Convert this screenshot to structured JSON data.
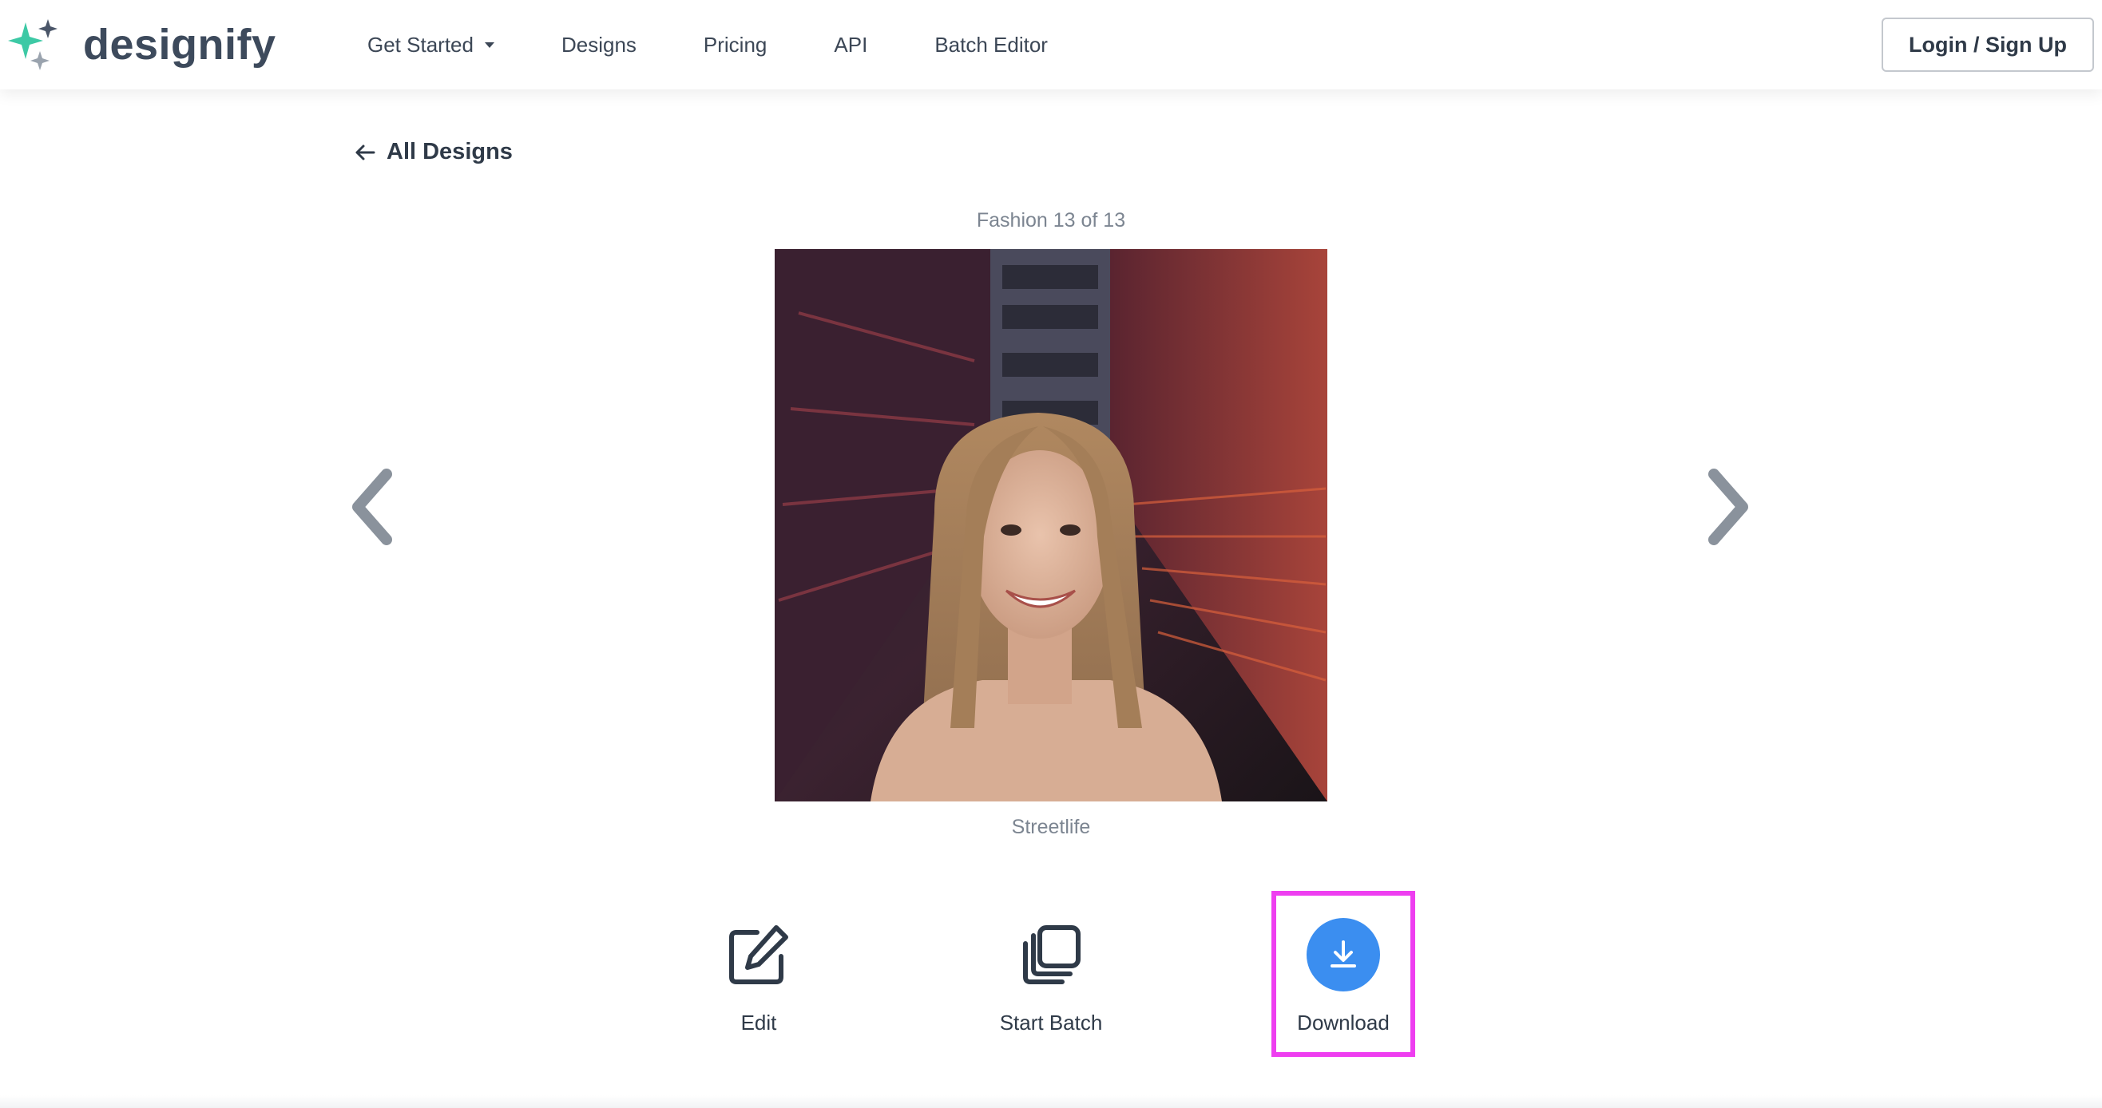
{
  "brand": {
    "name": "designify",
    "logo_icon": "sparkle-logo-icon",
    "accent_color": "#3dc9a5"
  },
  "nav": {
    "items": [
      {
        "label": "Get Started",
        "has_dropdown": true
      },
      {
        "label": "Designs"
      },
      {
        "label": "Pricing"
      },
      {
        "label": "API"
      },
      {
        "label": "Batch Editor"
      }
    ],
    "login_label": "Login / Sign Up"
  },
  "back_link": {
    "label": "All Designs",
    "icon": "arrow-left-icon"
  },
  "gallery": {
    "counter": "Fashion 13 of 13",
    "design_name": "Streetlife",
    "prev_icon": "chevron-left-icon",
    "next_icon": "chevron-right-icon"
  },
  "actions": {
    "edit": {
      "label": "Edit",
      "icon": "edit-icon"
    },
    "batch": {
      "label": "Start Batch",
      "icon": "stack-icon"
    },
    "download": {
      "label": "Download",
      "icon": "download-icon",
      "color": "#3b8ef0"
    }
  },
  "highlight_color": "#ee3ef0"
}
